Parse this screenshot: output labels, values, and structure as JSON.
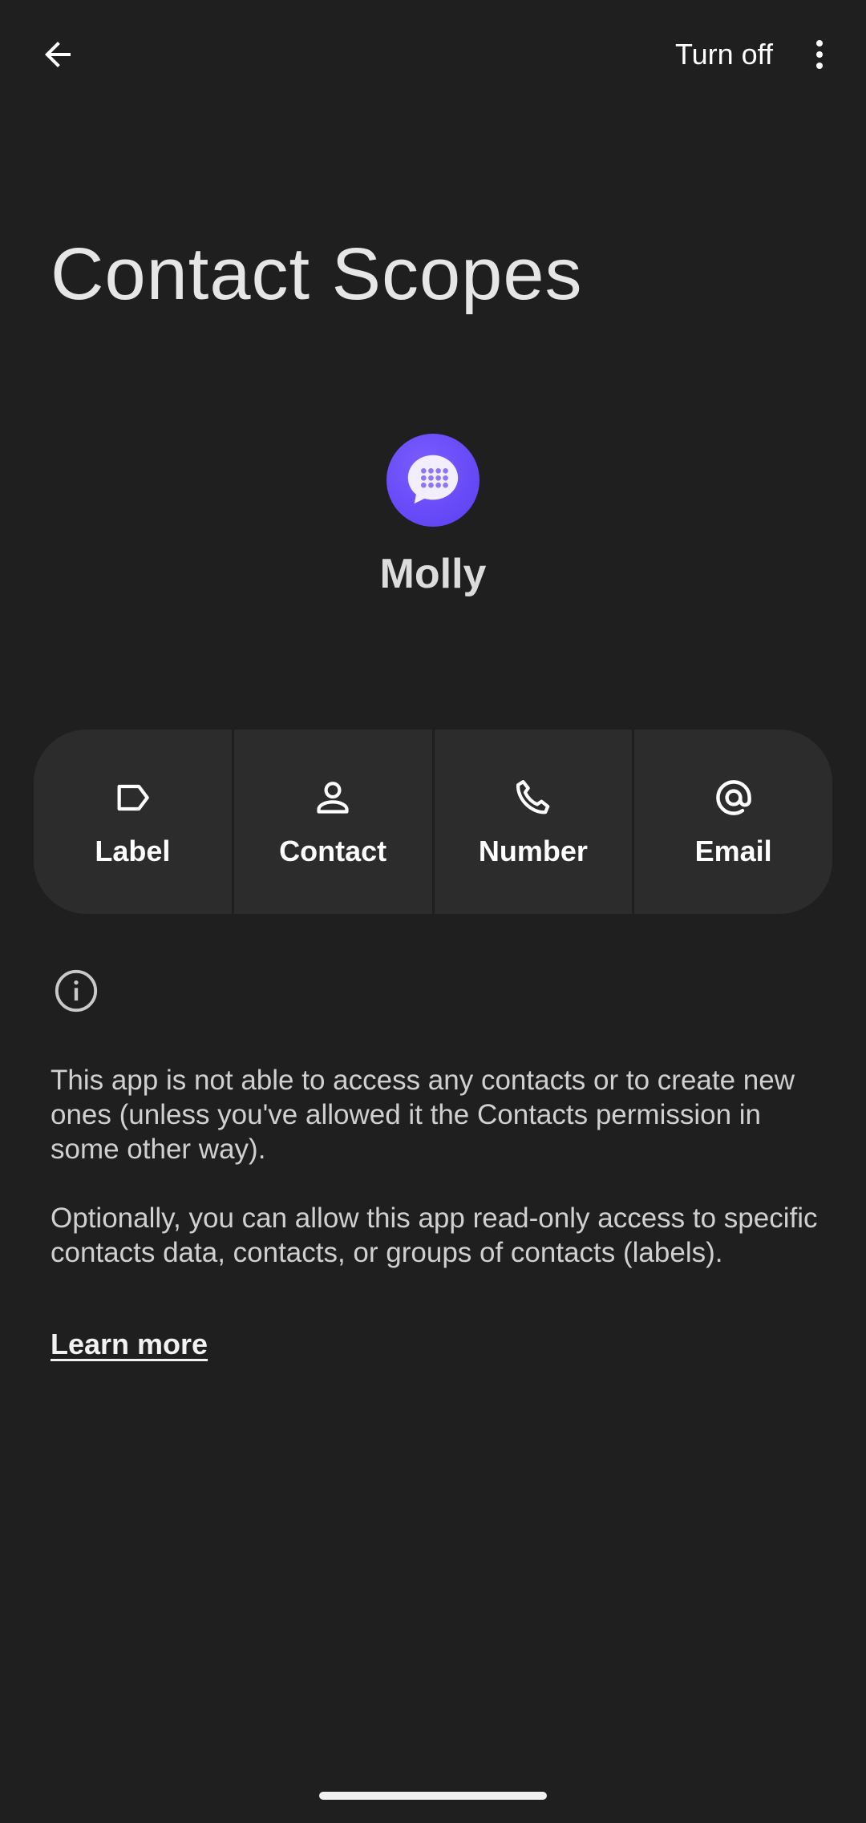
{
  "topbar": {
    "back_icon": "arrow-back-icon",
    "turn_off_label": "Turn off",
    "overflow_icon": "more-vert-icon"
  },
  "page": {
    "title": "Contact Scopes"
  },
  "app": {
    "name": "Molly",
    "icon": "molly-app-icon",
    "icon_color": "#6a4cf6"
  },
  "scopes": [
    {
      "label": "Label",
      "icon": "label-icon"
    },
    {
      "label": "Contact",
      "icon": "person-icon"
    },
    {
      "label": "Number",
      "icon": "phone-icon"
    },
    {
      "label": "Email",
      "icon": "at-sign-icon"
    }
  ],
  "info": {
    "icon": "info-icon",
    "paragraph1": "This app is not able to access any contacts or to create new ones (unless you've allowed it the Contacts permission in some other way).",
    "paragraph2": "Optionally, you can allow this app read-only access to specific contacts data, contacts, or groups of contacts (labels).",
    "learn_more": "Learn more"
  },
  "colors": {
    "background": "#1f1f1f",
    "surface": "#2c2c2c",
    "text": "#e3e3e3"
  }
}
